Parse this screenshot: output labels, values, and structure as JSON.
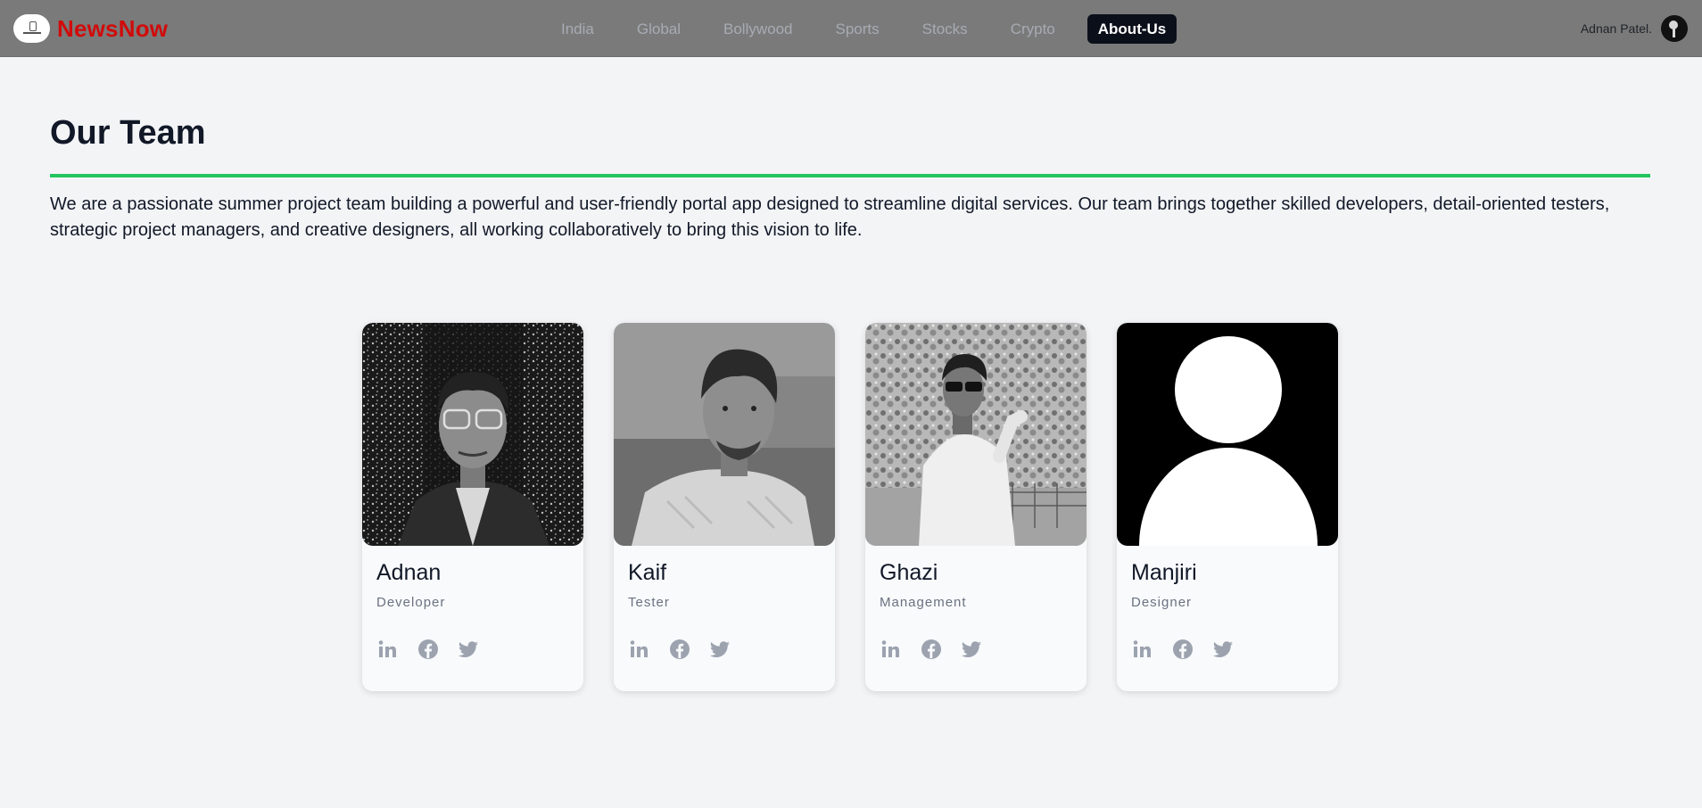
{
  "brand": {
    "name": "NewsNow",
    "logo_icon": "newsnow-logo-icon"
  },
  "nav": {
    "items": [
      {
        "label": "India"
      },
      {
        "label": "Global"
      },
      {
        "label": "Bollywood"
      },
      {
        "label": "Sports"
      },
      {
        "label": "Stocks"
      },
      {
        "label": "Crypto"
      },
      {
        "label": "About-Us",
        "active": true
      }
    ]
  },
  "user": {
    "name": "Adnan Patel.",
    "avatar_icon": "user-avatar-icon"
  },
  "page": {
    "title": "Our Team",
    "intro": "We are a passionate summer project team building a powerful and user-friendly portal app designed to streamline digital services. Our team brings together skilled developers, detail-oriented testers, strategic project managers, and creative designers, all working collaboratively to bring this vision to life."
  },
  "team": [
    {
      "name": "Adnan",
      "role": "Developer"
    },
    {
      "name": "Kaif",
      "role": "Tester"
    },
    {
      "name": "Ghazi",
      "role": "Management"
    },
    {
      "name": "Manjiri",
      "role": "Designer"
    }
  ],
  "social_icons": [
    "linkedin-icon",
    "facebook-icon",
    "twitter-icon"
  ],
  "colors": {
    "brand_red": "#d10a0a",
    "accent_green": "#22c55e",
    "active_nav_bg": "#0b0f19",
    "icon_gray": "#9ca3af"
  }
}
